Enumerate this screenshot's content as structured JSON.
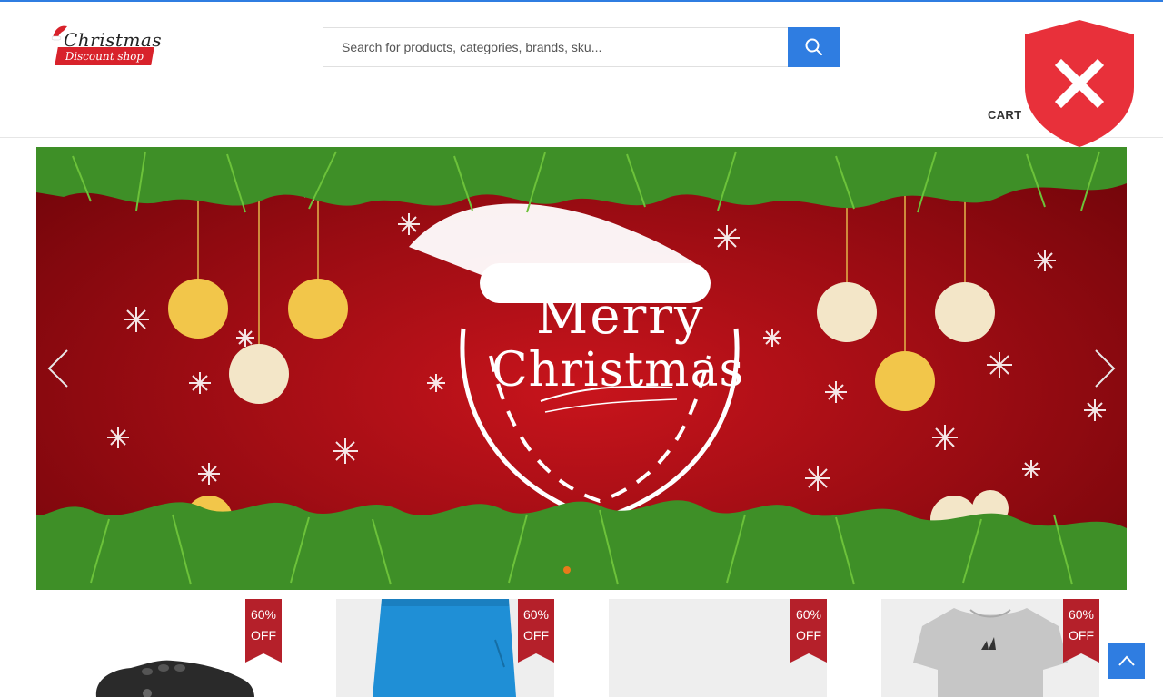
{
  "header": {
    "logo_title": "Christmas",
    "logo_subtitle": "Discount shop",
    "search_placeholder": "Search for products, categories, brands, sku...",
    "search_icon": "search-icon"
  },
  "nav": {
    "cart_label": "CART"
  },
  "security_overlay": {
    "icon": "shield-x-icon",
    "color": "#e8303a"
  },
  "hero": {
    "text_line1": "Merry",
    "text_line2": "Christmas",
    "prev_icon": "chevron-left-icon",
    "next_icon": "chevron-right-icon",
    "active_dot_color": "#e87a1a"
  },
  "products": [
    {
      "discount": "60%",
      "off": "OFF",
      "image": "clog-shoe"
    },
    {
      "discount": "60%",
      "off": "OFF",
      "image": "blue-shorts"
    },
    {
      "discount": "60%",
      "off": "OFF",
      "image": "blank"
    },
    {
      "discount": "60%",
      "off": "OFF",
      "image": "grey-tshirt"
    }
  ],
  "colors": {
    "accent": "#2f7de1",
    "badge": "#b5202a",
    "hero_red": "#b8101a"
  },
  "scroll_top_icon": "chevron-up-icon"
}
